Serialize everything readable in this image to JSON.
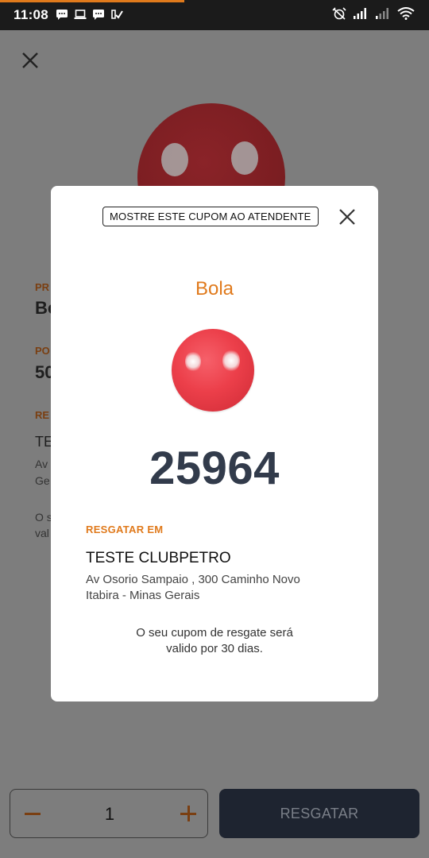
{
  "status_bar": {
    "time": "11:08",
    "progress_fraction": 0.43,
    "left_icons": [
      "message-icon",
      "laptop-icon",
      "message-icon",
      "check-icon"
    ],
    "right_icons": [
      "alarm-off-icon",
      "signal-icon",
      "signal-weak-icon",
      "wifi-icon"
    ]
  },
  "background_screen": {
    "labels": [
      "PR",
      "PO",
      "RE"
    ],
    "values": [
      "Bo",
      "50",
      "TE"
    ],
    "address_lines": [
      "Av",
      "Ge"
    ],
    "note_lines": [
      "O s",
      "val"
    ]
  },
  "quantity": {
    "value": "1"
  },
  "redeem_button": {
    "label": "RESGATAR"
  },
  "modal": {
    "coupon_tag": "MOSTRE ESTE CUPOM AO ATENDENTE",
    "product_name": "Bola",
    "coupon_code": "25964",
    "redeem_at_label": "RESGATAR EM",
    "store_name": "TESTE CLUBPETRO",
    "address_line1": "Av Osorio Sampaio , 300 Caminho Novo",
    "address_line2": "Itabira - Minas Gerais",
    "validity_line1": "O seu cupom de resgate será",
    "validity_line2": "valido por 30 dias."
  },
  "colors": {
    "accent_orange": "#e07a1c",
    "code_color": "#323b4b",
    "button_dark": "#1e2430",
    "ball_red": "#ec3f4a"
  }
}
